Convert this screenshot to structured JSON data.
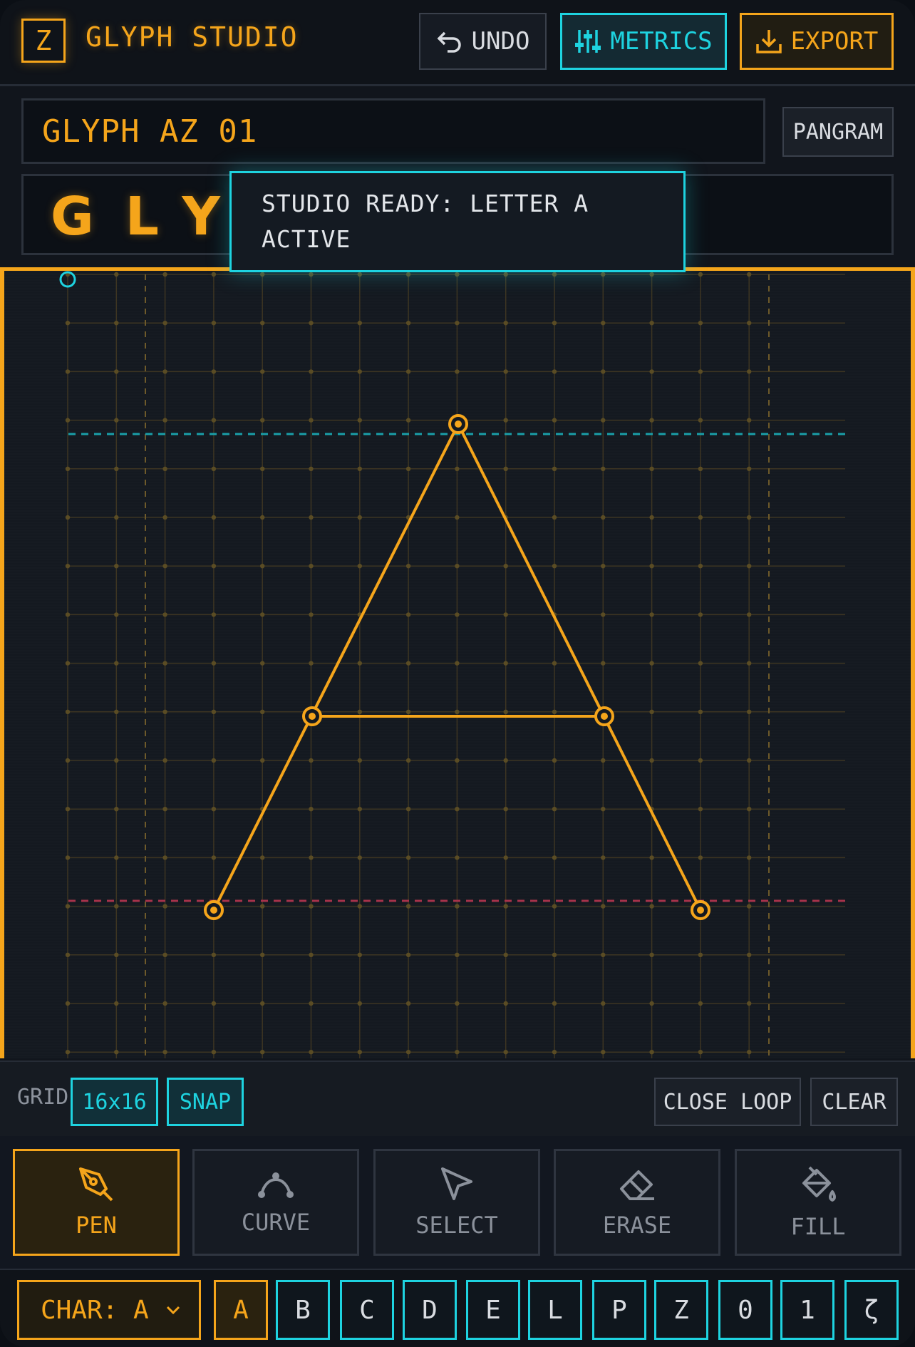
{
  "header": {
    "logo_letter": "Z",
    "app_title": "GLYPH STUDIO",
    "undo_label": "UNDO",
    "metrics_label": "METRICS",
    "export_label": "EXPORT"
  },
  "glyph_name": "GLYPH AZ 01",
  "pangram_label": "PANGRAM",
  "preview_text": "GLY",
  "toast": "STUDIO READY: LETTER A ACTIVE",
  "canvas": {
    "grid_size": 16,
    "snap": true,
    "points": [
      {
        "name": "apex"
      },
      {
        "name": "crossbar-left"
      },
      {
        "name": "crossbar-right"
      },
      {
        "name": "left-foot"
      },
      {
        "name": "right-foot"
      }
    ]
  },
  "gridbar": {
    "grid_label": "GRID",
    "grid_value": "16x16",
    "snap_label": "SNAP",
    "close_loop_label": "CLOSE LOOP",
    "clear_label": "CLEAR"
  },
  "tools": [
    {
      "label": "PEN",
      "icon": "pen-icon",
      "active": true
    },
    {
      "label": "CURVE",
      "icon": "curve-icon",
      "active": false
    },
    {
      "label": "SELECT",
      "icon": "cursor-icon",
      "active": false
    },
    {
      "label": "ERASE",
      "icon": "eraser-icon",
      "active": false
    },
    {
      "label": "FILL",
      "icon": "paint-bucket-icon",
      "active": false
    }
  ],
  "char_select_label": "CHAR: A",
  "glyphs": [
    "A",
    "B",
    "C",
    "D",
    "E",
    "L",
    "P",
    "Z",
    "0",
    "1",
    "ζ"
  ],
  "active_glyph": "A",
  "colors": {
    "accent": "#f5a51b",
    "cyan": "#1ed3e0",
    "baseline": "#b8324a",
    "background": "#11151c"
  }
}
